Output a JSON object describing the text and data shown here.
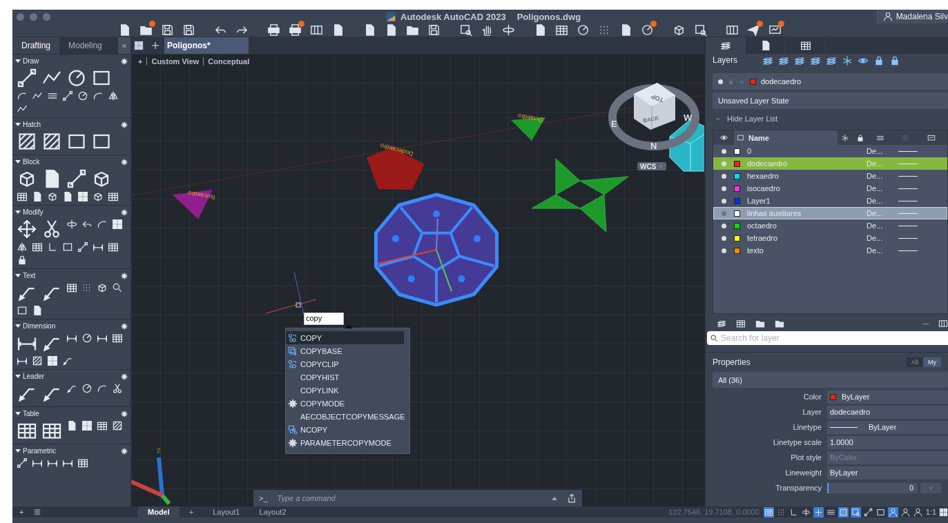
{
  "window": {
    "title": "Autodesk AutoCAD 2023",
    "document": "Poligonos.dwg",
    "user": "Madalena Silv"
  },
  "quick_access": [
    [
      {
        "badge": false
      },
      {
        "badge": true
      },
      {
        "badge": false
      },
      {
        "badge": false
      }
    ],
    [
      {
        "badge": false
      },
      {
        "badge": false
      }
    ],
    [
      {
        "badge": false
      },
      {
        "badge": true
      },
      {
        "badge": false
      },
      {
        "badge": false
      }
    ],
    [
      {
        "badge": false
      },
      {
        "badge": false
      },
      {
        "badge": false
      },
      {
        "badge": false
      }
    ],
    [
      {
        "badge": false
      },
      {
        "badge": false
      },
      {
        "badge": false
      }
    ],
    [
      {
        "badge": false
      },
      {
        "badge": false
      },
      {
        "badge": false
      },
      {
        "badge": false
      },
      {
        "badge": false
      },
      {
        "badge": true
      }
    ],
    [
      {
        "badge": false
      },
      {
        "badge": false
      }
    ],
    [
      {
        "badge": false
      },
      {
        "badge": true
      },
      {
        "badge": true
      }
    ]
  ],
  "tool_palette": {
    "tabs": [
      {
        "label": "Drafting",
        "selected": true
      },
      {
        "label": "Modeling",
        "selected": false
      }
    ],
    "collapse": "«",
    "sections": [
      {
        "title": "Draw",
        "expanded": true
      },
      {
        "title": "Hatch",
        "expanded": true
      },
      {
        "title": "Block",
        "expanded": true
      },
      {
        "title": "Modify",
        "expanded": true
      },
      {
        "title": "Text",
        "expanded": true
      },
      {
        "title": "Dimension",
        "expanded": true
      },
      {
        "title": "Leader",
        "expanded": true
      },
      {
        "title": "Table",
        "expanded": true
      },
      {
        "title": "Parametric",
        "expanded": true
      }
    ]
  },
  "document_tabs": [
    {
      "label": "Poligonos*",
      "selected": true
    }
  ],
  "viewport": {
    "controls": [
      "+",
      "Custom View",
      "Conceptual"
    ],
    "labels": [
      {
        "text": "Dodecaedro"
      },
      {
        "text": "Isocaedro"
      },
      {
        "text": "Octaedro"
      }
    ],
    "viewcube": {
      "top": "TOP",
      "side": "BACK",
      "compass": [
        "E",
        "N",
        "W"
      ],
      "ucs": "WCS"
    },
    "ucs_axis": "Z",
    "command_input": "copy",
    "suggestions": [
      {
        "label": "COPY",
        "kind": "copy",
        "selected": true
      },
      {
        "label": "COPYBASE",
        "kind": "copybase",
        "selected": false
      },
      {
        "label": "COPYCLIP",
        "kind": "copy",
        "selected": false
      },
      {
        "label": "COPYHIST",
        "kind": "plain",
        "selected": false
      },
      {
        "label": "COPYLINK",
        "kind": "plain",
        "selected": false
      },
      {
        "label": "COPYMODE",
        "kind": "setting",
        "selected": false
      },
      {
        "label": "AECOBJECTCOPYMESSAGE",
        "kind": "plain",
        "selected": false
      },
      {
        "label": "NCOPY",
        "kind": "ncopy",
        "selected": false
      },
      {
        "label": "PARAMETERCOPYMODE",
        "kind": "setting",
        "selected": false
      }
    ],
    "command_line": {
      "prompt": ">_",
      "placeholder": "Type a command"
    }
  },
  "panel_tabs": [
    {
      "selected": true
    },
    {
      "selected": false
    },
    {
      "selected": false
    }
  ],
  "layers": {
    "title": "Layers",
    "current": {
      "name": "dodecaedro",
      "color": "#ff2200"
    },
    "state": "Unsaved Layer State",
    "list_toggle": {
      "label": "Hide Layer List",
      "expanded": true
    },
    "name_column": "Name",
    "rows": [
      {
        "name": "0",
        "color": "#ffffff",
        "on": true,
        "selected": false,
        "hovered": false,
        "lineweight": "De..."
      },
      {
        "name": "dodecaedro",
        "color": "#ff2200",
        "on": true,
        "selected": true,
        "hovered": false,
        "lineweight": "De..."
      },
      {
        "name": "hexaedro",
        "color": "#00e0f0",
        "on": true,
        "selected": false,
        "hovered": false,
        "lineweight": "De..."
      },
      {
        "name": "isocaedro",
        "color": "#ff33ee",
        "on": true,
        "selected": false,
        "hovered": false,
        "lineweight": "De..."
      },
      {
        "name": "Layer1",
        "color": "#0033ff",
        "on": true,
        "selected": false,
        "hovered": false,
        "lineweight": "De..."
      },
      {
        "name": "linhas auxiliares",
        "color": "#ffffff",
        "on": false,
        "selected": false,
        "hovered": true,
        "lineweight": "De..."
      },
      {
        "name": "octaedro",
        "color": "#00dd00",
        "on": true,
        "selected": false,
        "hovered": false,
        "lineweight": "De..."
      },
      {
        "name": "tetraedro",
        "color": "#ffff00",
        "on": true,
        "selected": false,
        "hovered": false,
        "lineweight": "De..."
      },
      {
        "name": "texto",
        "color": "#ff8800",
        "on": true,
        "selected": false,
        "hovered": false,
        "lineweight": "De..."
      }
    ],
    "search_placeholder": "Search for layer"
  },
  "properties": {
    "title": "Properties",
    "scope": [
      {
        "label": "All",
        "selected": false
      },
      {
        "label": "My",
        "selected": true
      }
    ],
    "filter": "All (36)",
    "rows": [
      {
        "label": "Color",
        "value": "ByLayer",
        "kind": "color",
        "color": "#ff2200",
        "disabled": false
      },
      {
        "label": "Layer",
        "value": "dodecaedro",
        "kind": "dropdown",
        "disabled": false
      },
      {
        "label": "Linetype",
        "value": "ByLayer",
        "kind": "linetype",
        "disabled": false
      },
      {
        "label": "Linetype scale",
        "value": "1.0000",
        "kind": "text",
        "disabled": false
      },
      {
        "label": "Plot style",
        "value": "ByColor",
        "kind": "dropdown",
        "disabled": true
      },
      {
        "label": "Lineweight",
        "value": "ByLayer",
        "kind": "dropdown",
        "disabled": false
      },
      {
        "label": "Transparency",
        "value": "0",
        "kind": "slider",
        "disabled": false
      }
    ]
  },
  "status_bar": {
    "add_palette": "+",
    "layouts": [
      {
        "label": "Model",
        "selected": true
      },
      {
        "label": "Layout1",
        "selected": false
      },
      {
        "label": "Layout2",
        "selected": false
      }
    ],
    "add_layout": "+",
    "coordinates": "132.7546, 19.7108, 0.0000",
    "toggles": [
      {
        "on": true
      },
      {
        "on": false
      },
      {
        "on": false
      },
      {
        "on": false
      },
      {
        "on": true
      },
      {
        "on": false
      },
      {
        "on": true
      },
      {
        "on": true
      },
      {
        "on": false
      },
      {
        "on": false
      },
      {
        "on": true
      },
      {
        "on": false
      },
      {
        "on": false
      }
    ],
    "scale": "1:1"
  }
}
